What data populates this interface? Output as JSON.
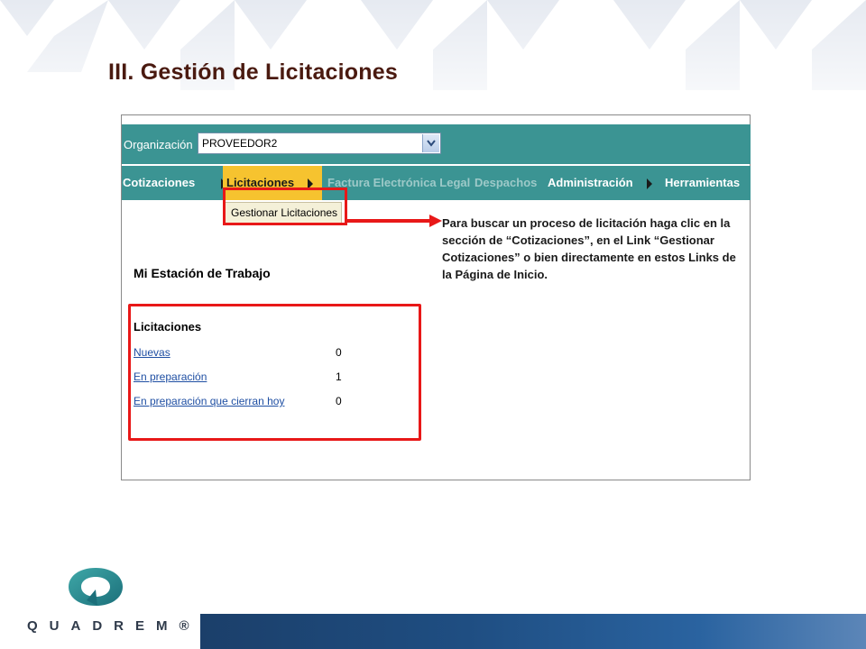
{
  "slide": {
    "title": "III.  Gestión de Licitaciones"
  },
  "screenshot": {
    "org_label": "Organización",
    "org_value": "PROVEEDOR2",
    "nav": [
      {
        "label": "Cotizaciones",
        "state": "normal"
      },
      {
        "label": "Licitaciones",
        "state": "active"
      },
      {
        "label": "Factura Electrónica Legal",
        "state": "disabled"
      },
      {
        "label": "Despachos",
        "state": "disabled"
      },
      {
        "label": "Administración",
        "state": "normal"
      },
      {
        "label": "Herramientas",
        "state": "normal"
      }
    ],
    "submenu_item": "Gestionar Licitaciones",
    "workstation_title": "Mi Estación de Trabajo",
    "licitaciones": {
      "title": "Licitaciones",
      "rows": [
        {
          "label": "Nuevas",
          "count": "0"
        },
        {
          "label": "En preparación",
          "count": "1"
        },
        {
          "label": "En preparación que cierran hoy",
          "count": "0"
        }
      ]
    }
  },
  "callout": {
    "text": "Para buscar un proceso de licitación haga clic en la sección de “Cotizaciones”, en el Link   “Gestionar Cotizaciones” o bien directamente en estos Links de la Página de  Inicio."
  },
  "footer": {
    "brand": "QUADREM®"
  },
  "colors": {
    "nav_teal": "#3b9493",
    "active_tab": "#f6c32f",
    "annotation_red": "#e81818",
    "title_brown": "#4a1a10",
    "footer_blue": "#1f4e82"
  },
  "icons": [
    "chevron-down-icon",
    "nav-arrow-icon",
    "red-arrow-icon",
    "quadrem-logo-icon"
  ]
}
